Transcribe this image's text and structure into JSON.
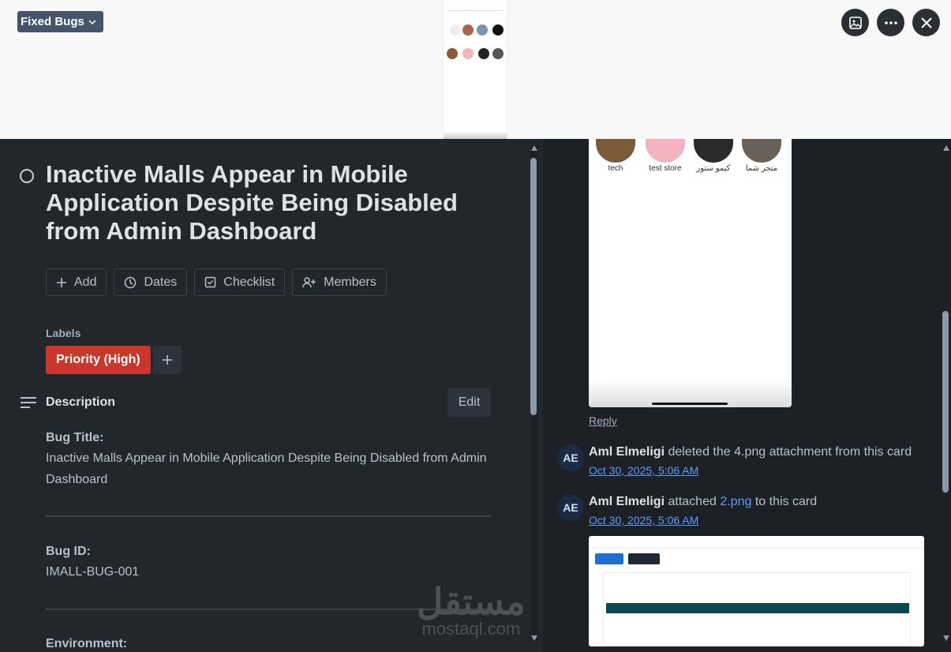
{
  "list_badge": "Fixed Bugs",
  "cover_actions": [
    "image-icon",
    "more-icon",
    "close-icon"
  ],
  "card": {
    "title": "Inactive Malls Appear in Mobile Application Despite Being Disabled from Admin Dashboard",
    "actions": [
      "Add",
      "Dates",
      "Checklist",
      "Members"
    ],
    "labels_heading": "Labels",
    "label": "Priority (High)",
    "description_heading": "Description",
    "edit_label": "Edit",
    "fields": [
      {
        "label": "Bug Title:",
        "value": "Inactive Malls Appear in Mobile Application Despite Being Disabled from Admin Dashboard"
      },
      {
        "label": "Bug ID:",
        "value": "IMALL-BUG-001"
      },
      {
        "label": "Environment:"
      }
    ]
  },
  "watermark": {
    "arabic": "مستقل",
    "latin": "mostaql.com"
  },
  "activity": {
    "stores": [
      "tech",
      "test store",
      "كيمو ستور",
      "متجر شما"
    ],
    "reply": "Reply",
    "items": [
      {
        "initials": "AE",
        "user": "Aml Elmeligi",
        "text": "deleted the 4.png attachment from this card",
        "time": "Oct 30, 2025, 5:06 AM"
      },
      {
        "initials": "AE",
        "user": "Aml Elmeligi",
        "text_before": "attached",
        "link": "2.png",
        "text_after": "to this card",
        "time": "Oct 30, 2025, 5:06 AM"
      }
    ]
  },
  "colors": {
    "priority": "#c9372c",
    "link": "#579dff",
    "panel": "#22272b"
  }
}
